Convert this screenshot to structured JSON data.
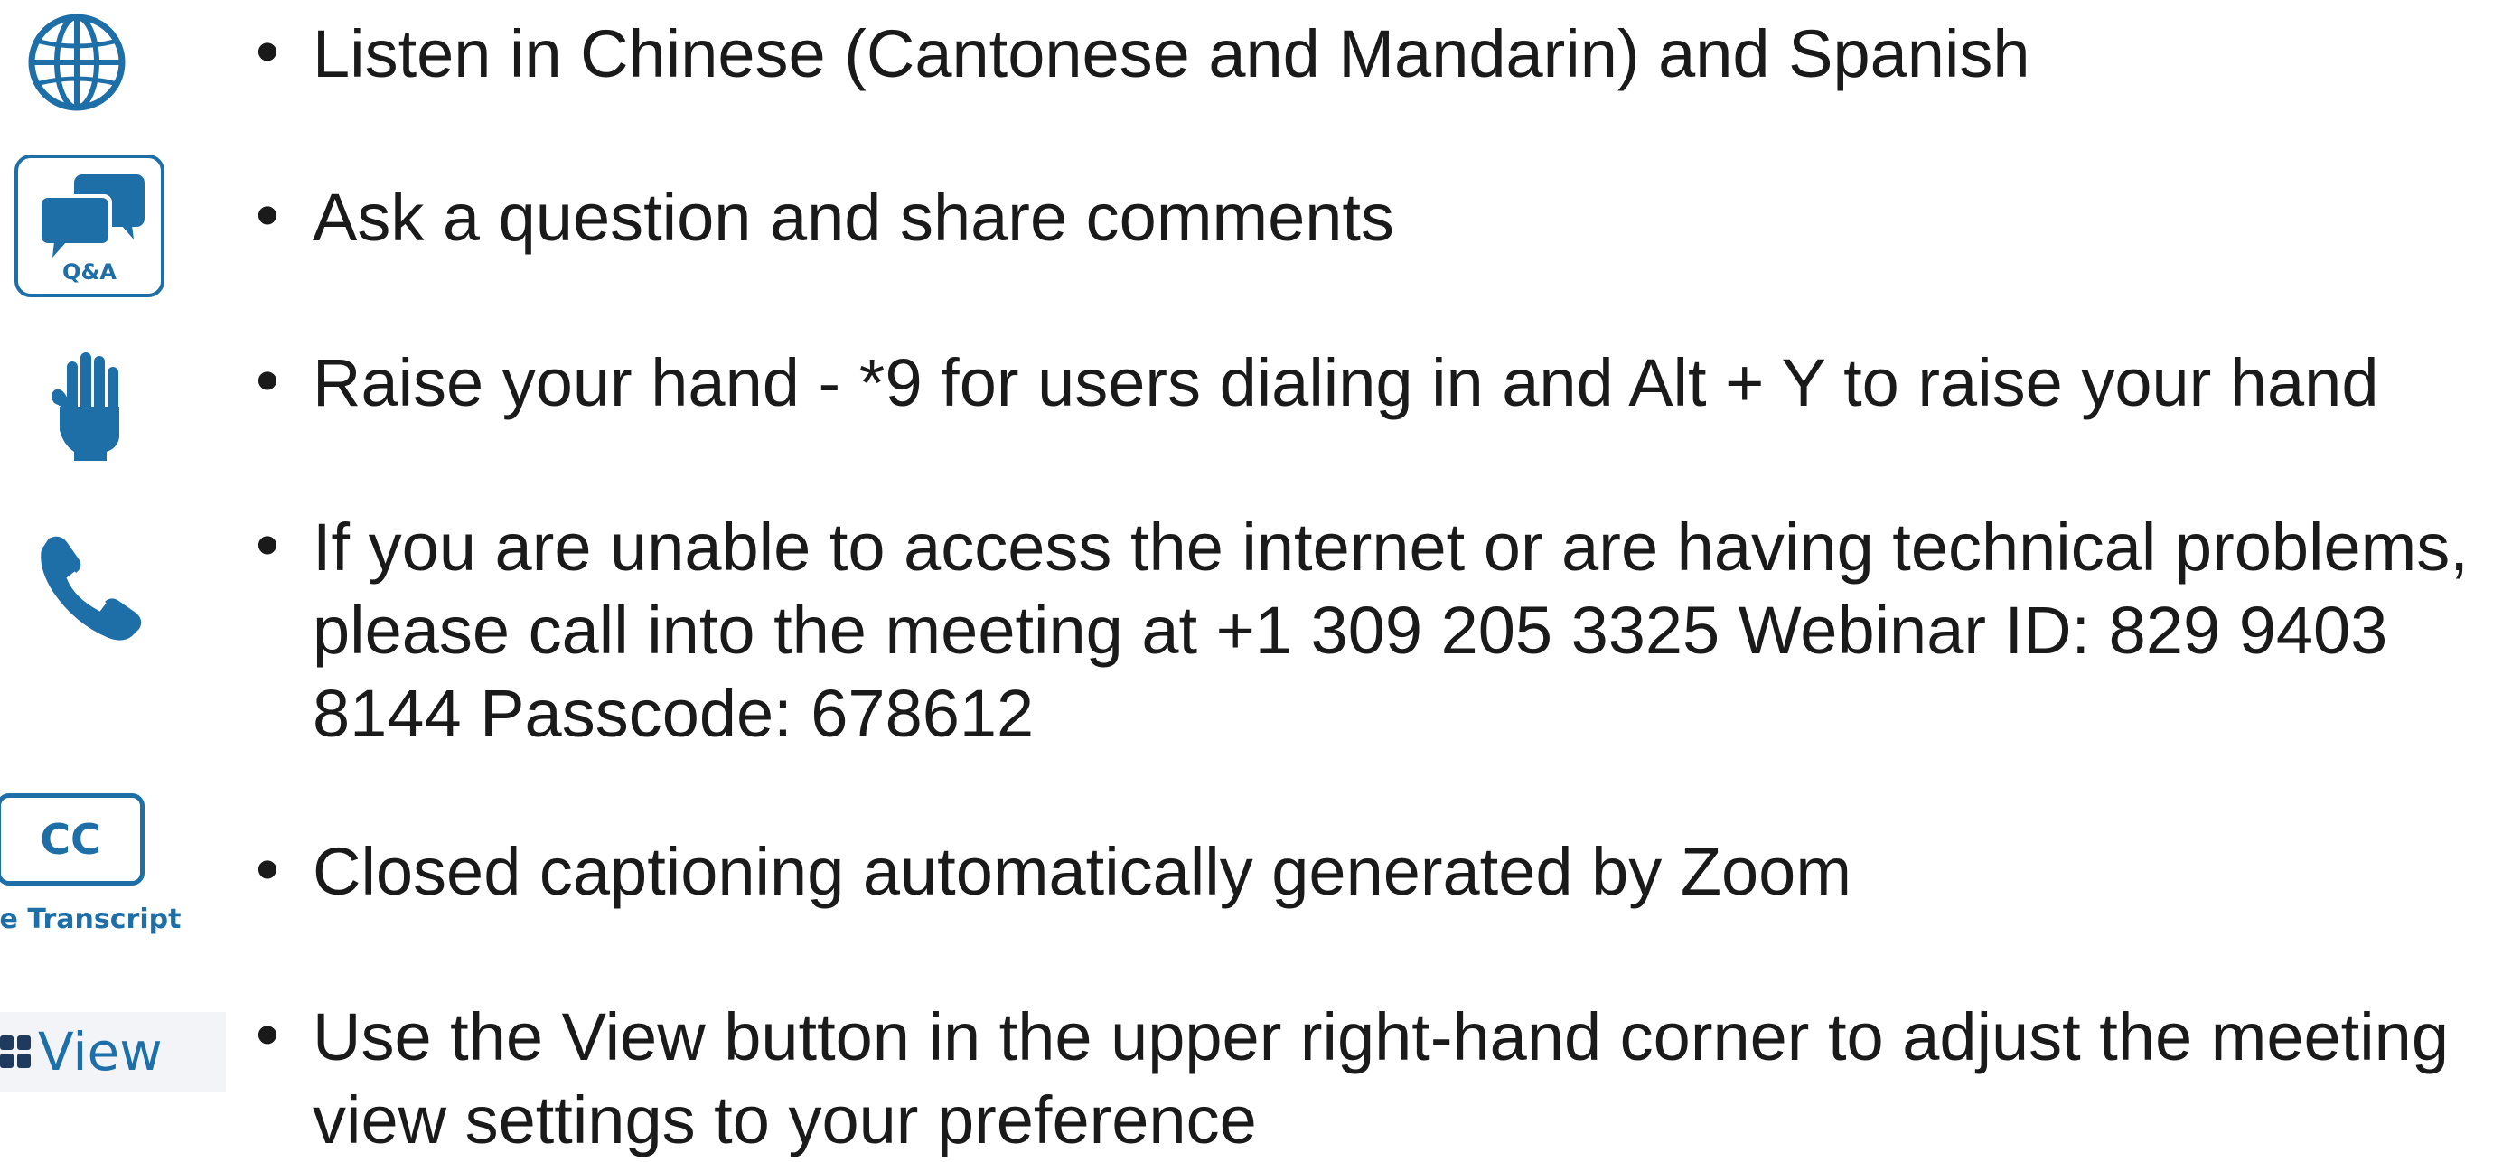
{
  "slide": {
    "items": [
      {
        "icon": "globe-icon",
        "text": "Listen in Chinese (Cantonese and Mandarin) and Spanish"
      },
      {
        "icon": "qa-chat-icon",
        "icon_label": "Q&A",
        "text": "Ask a question and share comments"
      },
      {
        "icon": "raised-hand-icon",
        "text": "Raise your hand - *9 for users dialing in and Alt + Y to raise your hand"
      },
      {
        "icon": "phone-icon",
        "text": "If you are unable to access the internet or are having technical problems,\nplease call into the meeting at +1 309 205 3325 Webinar ID: 829 9403\n8144 Passcode: 678612"
      },
      {
        "icon": "closed-caption-icon",
        "icon_label": "CC",
        "icon_sublabel": "ve Transcript",
        "text": "Closed captioning automatically generated by Zoom"
      },
      {
        "icon": "view-grid-icon",
        "icon_label": "View",
        "text": "Use the View button in the upper right-hand corner to adjust the meeting\nview settings to your preference"
      }
    ],
    "bullet": "•",
    "accent_color": "#1e6fa8"
  }
}
